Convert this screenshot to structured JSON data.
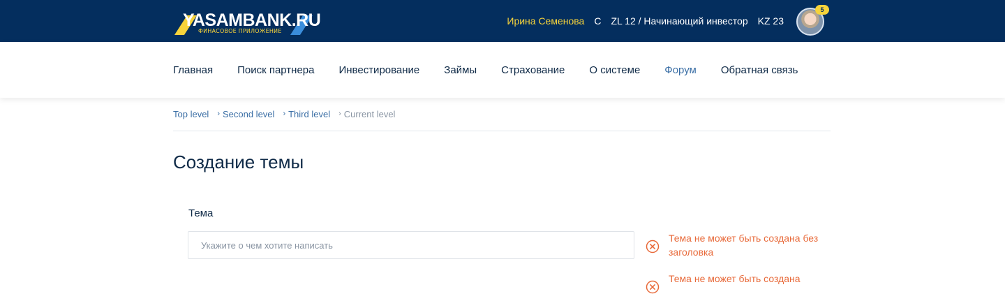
{
  "header": {
    "logo_text": "YASAMBANK.RU",
    "logo_subtitle": "ФИНАСОВОЕ ПРИЛОЖЕНИЕ",
    "user_name": "Ирина Семенова",
    "currency": "С",
    "level": "ZL 12 / Начинающий инвестор",
    "kz": "KZ 23",
    "notifications": "5"
  },
  "nav": {
    "items": [
      {
        "label": "Главная"
      },
      {
        "label": "Поиск партнера"
      },
      {
        "label": "Инвестирование"
      },
      {
        "label": "Займы"
      },
      {
        "label": "Страхование"
      },
      {
        "label": "О системе"
      },
      {
        "label": "Форум"
      },
      {
        "label": "Обратная связь"
      }
    ],
    "active": "Форум"
  },
  "breadcrumb": [
    "Top level",
    "Second level",
    "Third level",
    "Current level"
  ],
  "page": {
    "title": "Создание темы"
  },
  "form": {
    "topic_label": "Тема",
    "topic_placeholder": "Укажите о чем хотите написать",
    "topic_value": "",
    "errors": [
      "Тема не может быть создана без заголовка",
      "Тема не может быть создана"
    ]
  },
  "colors": {
    "header_bg": "#042e5e",
    "accent_yellow": "#f6d33b",
    "link_blue": "#3a6ea5",
    "error": "#e86a3a"
  }
}
